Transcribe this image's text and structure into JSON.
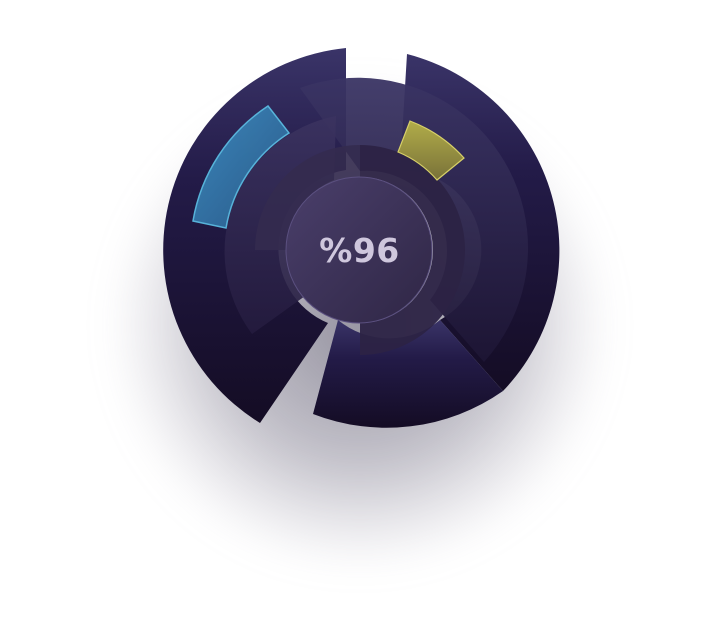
{
  "gauge": {
    "value_label": "%96",
    "value_percent": 96
  },
  "colors": {
    "background": "#ffffff",
    "dial_dark": "#1e1636",
    "dial_mid": "#2c2348",
    "dial_light": "#3f3763",
    "accent_blue": "#3a8fc0",
    "accent_yellow": "#c9c24a",
    "text": "#cfc7dd"
  }
}
